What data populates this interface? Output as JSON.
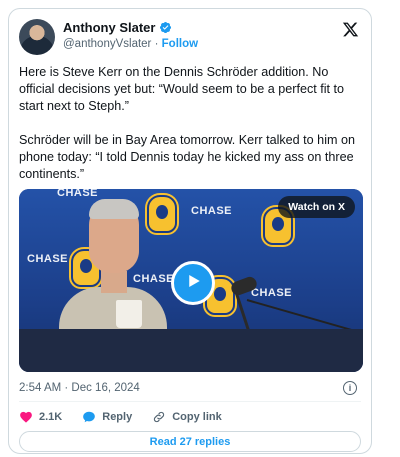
{
  "author": {
    "display_name": "Anthony Slater",
    "handle": "@anthonyVslater",
    "separator": "·",
    "follow_label": "Follow"
  },
  "tweet": {
    "paragraphs": [
      "Here is Steve Kerr on the Dennis Schröder addition. No official decisions yet but: “Would seem to be a perfect fit to start next to Steph.”",
      "Schröder will be in Bay Area tomorrow. Kerr talked to him on phone today: “I told Dennis today he kicked my ass on three continents.”"
    ],
    "timestamp": "2:54 AM · Dec 16, 2024"
  },
  "media": {
    "watch_label": "Watch on X",
    "backdrop_text": {
      "chase_1": "CHASE",
      "chase_2": "CHASE",
      "chase_3": "CHASE",
      "chase_4": "CHASE",
      "chase_5": "CHASE"
    }
  },
  "actions": {
    "likes_count": "2.1K",
    "reply_label": "Reply",
    "copy_link_label": "Copy link"
  },
  "read_replies_label": "Read 27 replies",
  "colors": {
    "accent": "#1d9bf0",
    "like": "#f91880",
    "text": "#0f1419",
    "muted": "#536471",
    "border": "#cfd9de"
  },
  "icons": {
    "x_logo": "x-logo-icon",
    "verified": "verified-badge-icon",
    "play": "play-icon",
    "info": "info-icon",
    "like": "heart-icon",
    "reply": "speech-bubble-icon",
    "copy_link": "link-icon"
  }
}
